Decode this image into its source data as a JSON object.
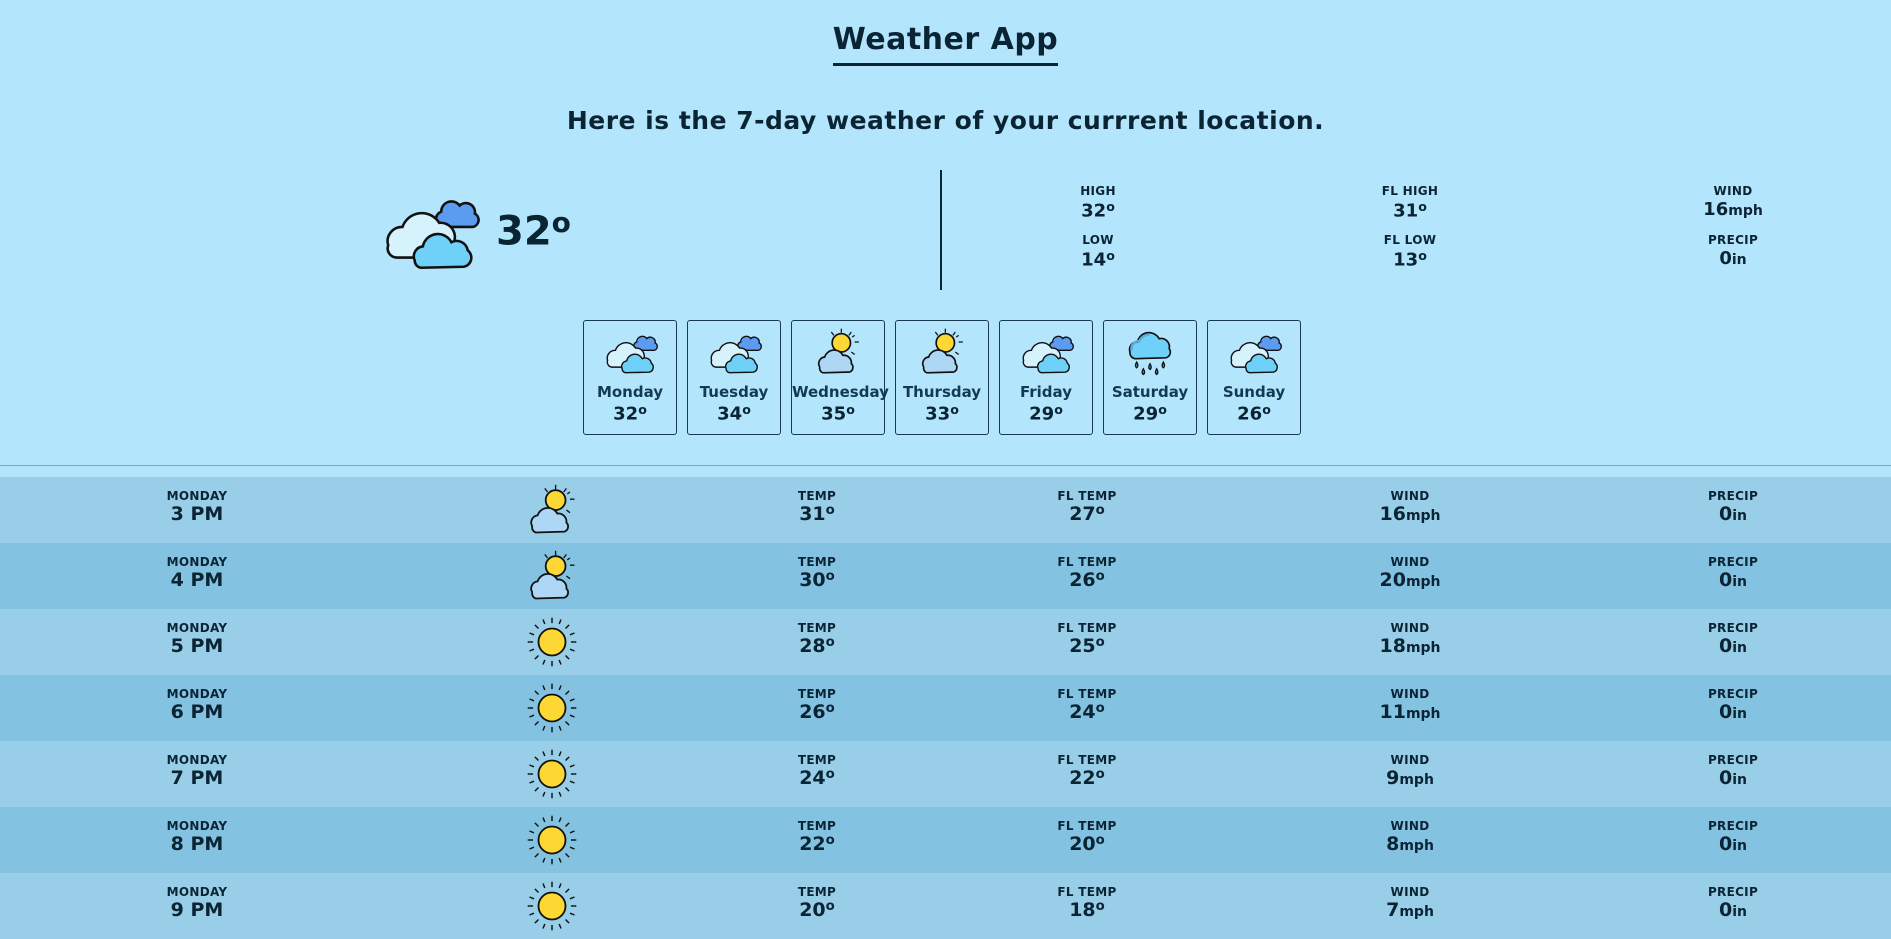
{
  "app": {
    "title": "Weather App",
    "subtitle": "Here is the 7-day weather of your currrent location."
  },
  "current": {
    "icon": "clouds-icon",
    "temp": "32",
    "high_label": "HIGH",
    "high": "32",
    "low_label": "FL LOW",
    "low_label_plain": "LOW",
    "low": "14",
    "fl_high_label": "FL HIGH",
    "fl_high": "31",
    "fl_low": "13",
    "wind_label": "WIND",
    "wind": "16",
    "wind_unit": "mph",
    "precip_label": "PRECIP",
    "precip": "0",
    "precip_unit": "in",
    "degree": "o"
  },
  "days": [
    {
      "name": "Monday",
      "temp": "32",
      "icon": "clouds-icon"
    },
    {
      "name": "Tuesday",
      "temp": "34",
      "icon": "clouds-icon"
    },
    {
      "name": "Wednesday",
      "temp": "35",
      "icon": "sun-cloud-icon"
    },
    {
      "name": "Thursday",
      "temp": "33",
      "icon": "sun-cloud-icon"
    },
    {
      "name": "Friday",
      "temp": "29",
      "icon": "clouds-icon"
    },
    {
      "name": "Saturday",
      "temp": "29",
      "icon": "rain-icon"
    },
    {
      "name": "Sunday",
      "temp": "26",
      "icon": "clouds-icon"
    }
  ],
  "hourly_labels": {
    "temp": "TEMP",
    "fl_temp": "FL TEMP",
    "wind": "WIND",
    "precip": "PRECIP",
    "wind_unit": "mph",
    "precip_unit": "in"
  },
  "hourly": [
    {
      "day": "MONDAY",
      "time": "3 PM",
      "icon": "sun-cloud-icon",
      "temp": "31",
      "fl_temp": "27",
      "wind": "16",
      "precip": "0"
    },
    {
      "day": "MONDAY",
      "time": "4 PM",
      "icon": "sun-cloud-icon",
      "temp": "30",
      "fl_temp": "26",
      "wind": "20",
      "precip": "0"
    },
    {
      "day": "MONDAY",
      "time": "5 PM",
      "icon": "sun-icon",
      "temp": "28",
      "fl_temp": "25",
      "wind": "18",
      "precip": "0"
    },
    {
      "day": "MONDAY",
      "time": "6 PM",
      "icon": "sun-icon",
      "temp": "26",
      "fl_temp": "24",
      "wind": "11",
      "precip": "0"
    },
    {
      "day": "MONDAY",
      "time": "7 PM",
      "icon": "sun-icon",
      "temp": "24",
      "fl_temp": "22",
      "wind": "9",
      "precip": "0"
    },
    {
      "day": "MONDAY",
      "time": "8 PM",
      "icon": "sun-icon",
      "temp": "22",
      "fl_temp": "20",
      "wind": "8",
      "precip": "0"
    },
    {
      "day": "MONDAY",
      "time": "9 PM",
      "icon": "sun-icon",
      "temp": "20",
      "fl_temp": "18",
      "wind": "7",
      "precip": "0"
    }
  ],
  "colors": {
    "background": "#b3e5fc",
    "row_odd": "#99cee8",
    "row_even": "#83c3e1",
    "text": "#0b2434"
  }
}
